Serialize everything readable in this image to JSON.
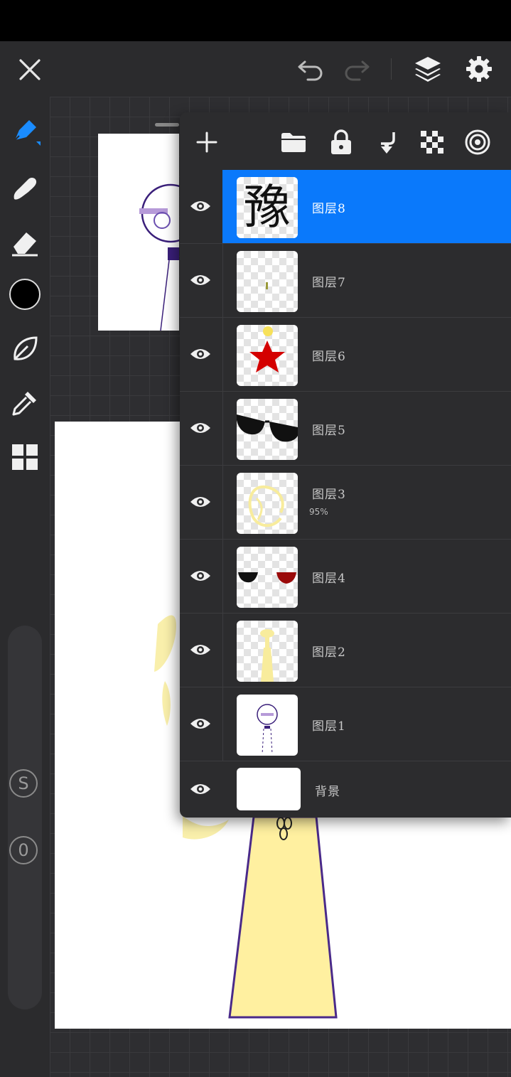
{
  "topbar": {
    "close_icon": "close-icon",
    "undo_icon": "undo-icon",
    "redo_icon": "redo-icon",
    "layers_icon": "layers-icon",
    "settings_icon": "gear-icon"
  },
  "tools": [
    {
      "name": "brush-icon"
    },
    {
      "name": "smudge-icon"
    },
    {
      "name": "eraser-icon"
    },
    {
      "name": "color-swatch",
      "color": "#000000"
    },
    {
      "name": "leaf-icon"
    },
    {
      "name": "eyedropper-icon"
    },
    {
      "name": "grid-icon"
    }
  ],
  "slider": {
    "s_label": "S",
    "o_label": "0"
  },
  "layers_panel": {
    "toolbar_icons": [
      "add-layer-icon",
      "folder-icon",
      "lock-icon",
      "merge-down-icon",
      "checkerboard-icon",
      "target-icon"
    ],
    "layers": [
      {
        "name": "图层8",
        "opacity": "",
        "selected": true,
        "thumb": "glyph"
      },
      {
        "name": "图层7",
        "opacity": "",
        "selected": false,
        "thumb": "tiny"
      },
      {
        "name": "图层6",
        "opacity": "",
        "selected": false,
        "thumb": "star"
      },
      {
        "name": "图层5",
        "opacity": "",
        "selected": false,
        "thumb": "sunglasses"
      },
      {
        "name": "图层3",
        "opacity": "95%",
        "selected": false,
        "thumb": "hair"
      },
      {
        "name": "图层4",
        "opacity": "",
        "selected": false,
        "thumb": "eyes"
      },
      {
        "name": "图层2",
        "opacity": "",
        "selected": false,
        "thumb": "body"
      },
      {
        "name": "图层1",
        "opacity": "",
        "selected": false,
        "thumb": "sketch"
      },
      {
        "name": "背景",
        "opacity": "",
        "selected": false,
        "thumb": "white"
      }
    ],
    "thumb_glyph": "豫"
  },
  "colors": {
    "accent": "#0a79fb",
    "panel": "#2c2c2e",
    "dress_yellow": "#fff0a0",
    "dress_outline": "#4a2a8a",
    "star_red": "#d40000"
  }
}
